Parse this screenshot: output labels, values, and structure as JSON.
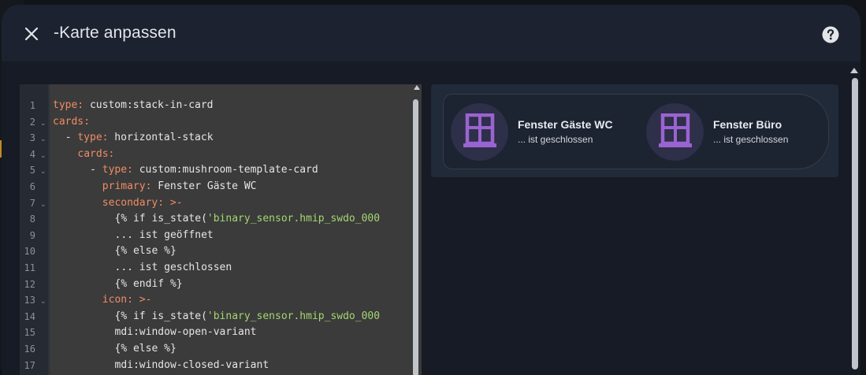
{
  "dialog": {
    "title": "-Karte anpassen",
    "close_icon": "close-icon",
    "help_icon": "help-circle-icon"
  },
  "editor": {
    "lines": [
      {
        "n": "1",
        "fold": "",
        "indent": 0,
        "tokens": [
          [
            "k",
            "type:"
          ],
          [
            "t",
            " custom:stack-in-card"
          ]
        ]
      },
      {
        "n": "2",
        "fold": "v",
        "indent": 0,
        "tokens": [
          [
            "k",
            "cards:"
          ]
        ]
      },
      {
        "n": "3",
        "fold": "v",
        "indent": 2,
        "tokens": [
          [
            "t",
            "- "
          ],
          [
            "k",
            "type:"
          ],
          [
            "t",
            " horizontal-stack"
          ]
        ]
      },
      {
        "n": "4",
        "fold": "v",
        "indent": 4,
        "tokens": [
          [
            "k",
            "cards:"
          ]
        ]
      },
      {
        "n": "5",
        "fold": "v",
        "indent": 6,
        "tokens": [
          [
            "t",
            "- "
          ],
          [
            "k",
            "type:"
          ],
          [
            "t",
            " custom:mushroom-template-card"
          ]
        ]
      },
      {
        "n": "6",
        "fold": "",
        "indent": 8,
        "tokens": [
          [
            "k",
            "primary:"
          ],
          [
            "t",
            " Fenster Gäste WC"
          ]
        ]
      },
      {
        "n": "7",
        "fold": "v",
        "indent": 8,
        "tokens": [
          [
            "k",
            "secondary:"
          ],
          [
            "k",
            " >-"
          ]
        ]
      },
      {
        "n": "8",
        "fold": "",
        "indent": 10,
        "tokens": [
          [
            "t",
            "{% if is_state("
          ],
          [
            "s",
            "'binary_sensor.hmip_swdo_000"
          ]
        ]
      },
      {
        "n": "9",
        "fold": "",
        "indent": 10,
        "tokens": [
          [
            "t",
            "... ist geöffnet"
          ]
        ]
      },
      {
        "n": "10",
        "fold": "",
        "indent": 10,
        "tokens": [
          [
            "t",
            "{% else %}"
          ]
        ]
      },
      {
        "n": "11",
        "fold": "",
        "indent": 10,
        "tokens": [
          [
            "t",
            "... ist geschlossen"
          ]
        ]
      },
      {
        "n": "12",
        "fold": "",
        "indent": 10,
        "tokens": [
          [
            "t",
            "{% endif %}"
          ]
        ]
      },
      {
        "n": "13",
        "fold": "v",
        "indent": 8,
        "tokens": [
          [
            "k",
            "icon:"
          ],
          [
            "k",
            " >-"
          ]
        ]
      },
      {
        "n": "14",
        "fold": "",
        "indent": 10,
        "tokens": [
          [
            "t",
            "{% if is_state("
          ],
          [
            "s",
            "'binary_sensor.hmip_swdo_000"
          ]
        ]
      },
      {
        "n": "15",
        "fold": "",
        "indent": 10,
        "tokens": [
          [
            "t",
            "mdi:window-open-variant"
          ]
        ]
      },
      {
        "n": "16",
        "fold": "",
        "indent": 10,
        "tokens": [
          [
            "t",
            "{% else %}"
          ]
        ]
      },
      {
        "n": "17",
        "fold": "",
        "indent": 10,
        "tokens": [
          [
            "t",
            "mdi:window-closed-variant"
          ]
        ]
      }
    ]
  },
  "preview": {
    "chips": [
      {
        "primary": "Fenster Gäste WC",
        "secondary": "... ist geschlossen",
        "icon": "window-closed-variant-icon"
      },
      {
        "primary": "Fenster Büro",
        "secondary": "... ist geschlossen",
        "icon": "window-closed-variant-icon"
      }
    ],
    "icon_color": "#9a63d2",
    "icon_bg": "#2e2f48"
  },
  "colors": {
    "key": "#f08c66",
    "string": "#a5d672",
    "text": "#e6e6e6"
  }
}
